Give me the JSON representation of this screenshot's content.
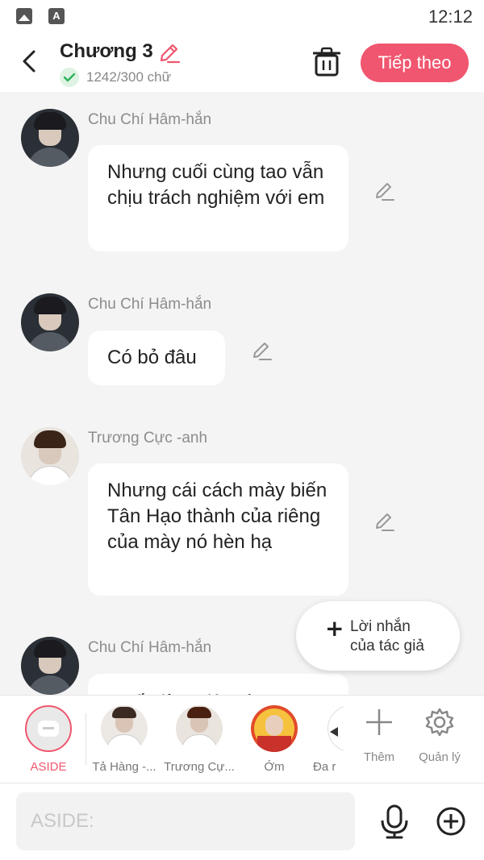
{
  "status_bar": {
    "time": "12:12",
    "icons": [
      "image-icon",
      "font-icon"
    ]
  },
  "header": {
    "title": "Chương 3",
    "word_count": "1242/300 chữ",
    "next_label": "Tiếp theo"
  },
  "messages": [
    {
      "sender": "Chu Chí Hâm-hắn",
      "text": "Nhưng cuối cùng tao vẫn chịu trách nghiệm với em"
    },
    {
      "sender": "Chu Chí Hâm-hắn",
      "text": "Có bỏ đâu"
    },
    {
      "sender": "Trương Cực -anh",
      "text": "Nhưng cái cách mày biến Tân Hạo thành của riêng của mày nó hèn hạ"
    },
    {
      "sender": "Chu Chí Hâm-hắn",
      "text": "Muốn làm việc gì"
    }
  ],
  "author_note": {
    "label_line1": "Lời nhắn",
    "label_line2": "của tác giả"
  },
  "characters": [
    {
      "name": "ASIDE"
    },
    {
      "name": "Tả Hàng -..."
    },
    {
      "name": "Trương Cự..."
    },
    {
      "name": "Ởm"
    },
    {
      "name": "Đa r"
    }
  ],
  "tools": {
    "add_label": "Thêm",
    "manage_label": "Quản lý"
  },
  "input": {
    "placeholder": "ASIDE:"
  },
  "colors": {
    "accent": "#f0566f",
    "background": "#f4f4f4",
    "bubble": "#ffffff"
  }
}
